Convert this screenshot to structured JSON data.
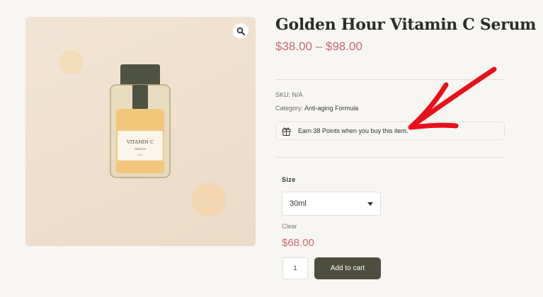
{
  "product": {
    "title": "Golden Hour Vitamin C Serum",
    "price_range": "$38.00 – $98.00",
    "sku_label": "SKU:",
    "sku_value": "N/A",
    "category_label": "Category:",
    "category_value": "Anti-aging Formula"
  },
  "image": {
    "label_line1": "VITAMIN C",
    "label_line2": "SERUM",
    "label_line3": "30ml",
    "zoom_icon": "magnifier-icon"
  },
  "points": {
    "icon": "gift-icon",
    "text": "Earn 38 Points when you buy this item."
  },
  "variation": {
    "size_label": "Size",
    "selected": "30ml",
    "clear_label": "Clear",
    "price": "$68.00"
  },
  "cart": {
    "quantity": "1",
    "add_label": "Add to cart"
  },
  "colors": {
    "accent_price": "#c96a74",
    "button": "#4e4e3e",
    "annotation_arrow": "#e8101a"
  }
}
